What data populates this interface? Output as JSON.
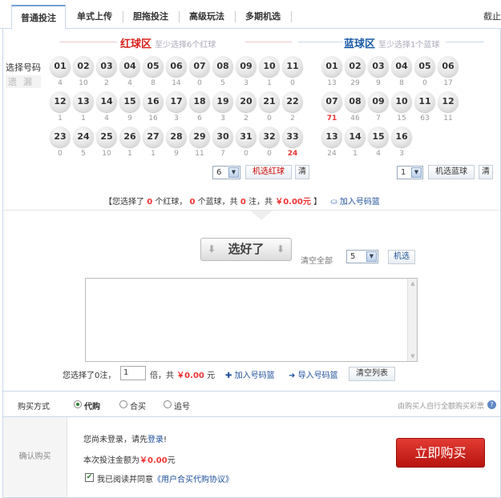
{
  "tabs": [
    {
      "label": "普通投注",
      "active": true
    },
    {
      "label": "单式上传",
      "active": false
    },
    {
      "label": "胆拖投注",
      "active": false
    },
    {
      "label": "高级玩法",
      "active": false
    },
    {
      "label": "多期机选",
      "active": false
    }
  ],
  "tab_right": "截止",
  "red_zone": {
    "title": "红球区",
    "hint": "至少选择6个红球"
  },
  "blue_zone": {
    "title": "蓝球区",
    "hint": "至少选择1个蓝球"
  },
  "labels": {
    "select_number": "选择号码",
    "omission": "遗漏"
  },
  "red_balls": [
    {
      "num": "01",
      "miss": "4"
    },
    {
      "num": "02",
      "miss": "10"
    },
    {
      "num": "03",
      "miss": "2"
    },
    {
      "num": "04",
      "miss": "4"
    },
    {
      "num": "05",
      "miss": "8"
    },
    {
      "num": "06",
      "miss": "14"
    },
    {
      "num": "07",
      "miss": "0"
    },
    {
      "num": "08",
      "miss": "5"
    },
    {
      "num": "09",
      "miss": "3"
    },
    {
      "num": "10",
      "miss": "1"
    },
    {
      "num": "11",
      "miss": "0"
    },
    {
      "num": "12",
      "miss": "1"
    },
    {
      "num": "13",
      "miss": "1"
    },
    {
      "num": "14",
      "miss": "4"
    },
    {
      "num": "15",
      "miss": "9"
    },
    {
      "num": "16",
      "miss": "16"
    },
    {
      "num": "17",
      "miss": "3"
    },
    {
      "num": "18",
      "miss": "6"
    },
    {
      "num": "19",
      "miss": "3"
    },
    {
      "num": "20",
      "miss": "2"
    },
    {
      "num": "21",
      "miss": "0"
    },
    {
      "num": "22",
      "miss": "2"
    },
    {
      "num": "23",
      "miss": "0"
    },
    {
      "num": "24",
      "miss": "5"
    },
    {
      "num": "25",
      "miss": "10"
    },
    {
      "num": "26",
      "miss": "1"
    },
    {
      "num": "27",
      "miss": "1"
    },
    {
      "num": "28",
      "miss": "9"
    },
    {
      "num": "29",
      "miss": "11"
    },
    {
      "num": "30",
      "miss": "7"
    },
    {
      "num": "31",
      "miss": "0"
    },
    {
      "num": "32",
      "miss": "0"
    },
    {
      "num": "33",
      "miss": "24"
    }
  ],
  "blue_balls": [
    {
      "num": "01",
      "miss": "13"
    },
    {
      "num": "02",
      "miss": "29"
    },
    {
      "num": "03",
      "miss": "9"
    },
    {
      "num": "04",
      "miss": "8"
    },
    {
      "num": "05",
      "miss": "0"
    },
    {
      "num": "06",
      "miss": "17"
    },
    {
      "num": "07",
      "miss": "71"
    },
    {
      "num": "08",
      "miss": "46"
    },
    {
      "num": "09",
      "miss": "7"
    },
    {
      "num": "10",
      "miss": "15"
    },
    {
      "num": "11",
      "miss": "63"
    },
    {
      "num": "12",
      "miss": "11"
    },
    {
      "num": "13",
      "miss": "24"
    },
    {
      "num": "14",
      "miss": "1"
    },
    {
      "num": "15",
      "miss": "4"
    },
    {
      "num": "16",
      "miss": "3"
    }
  ],
  "red_random": {
    "count": "6",
    "label": "机选红球",
    "clear": "清"
  },
  "blue_random": {
    "count": "1",
    "label": "机选蓝球",
    "clear": "清"
  },
  "summary": {
    "p1": "【您选择了",
    "red_count": "0",
    "p2": "个红球，",
    "blue_count": "0",
    "p3": "个蓝球，共",
    "notes": "0",
    "p4": "注，共",
    "amount": "￥0.00元",
    "p5": "】",
    "add_basket": "加入号码篮"
  },
  "confirm_button": "选好了",
  "clear_all": "清空全部",
  "random_count": "5",
  "random_button": "机选",
  "multi": {
    "p1": "您选择了0注，",
    "value": "1",
    "p2": "倍，共",
    "amount": "￥0.00",
    "p3": "元"
  },
  "actions": {
    "add_basket": "加入号码篮",
    "import_basket": "导入号码篮",
    "clear_list": "清空列表"
  },
  "buy_method": {
    "label": "购买方式",
    "options": [
      {
        "label": "代购",
        "selected": true
      },
      {
        "label": "合买",
        "selected": false
      },
      {
        "label": "追号",
        "selected": false
      }
    ],
    "right_note": "由购买人自行全额购买彩票"
  },
  "confirm": {
    "label": "确认购买",
    "login_text": "您尚未登录，请先",
    "login_link": "登录",
    "login_end": "!",
    "amount_text": "本次投注金额为",
    "amount": "￥0.00",
    "amount_unit": "元",
    "agree_text": "我已阅读并同意",
    "agree_link": "《用户合买代购协议》",
    "buy_button": "立即购买"
  }
}
